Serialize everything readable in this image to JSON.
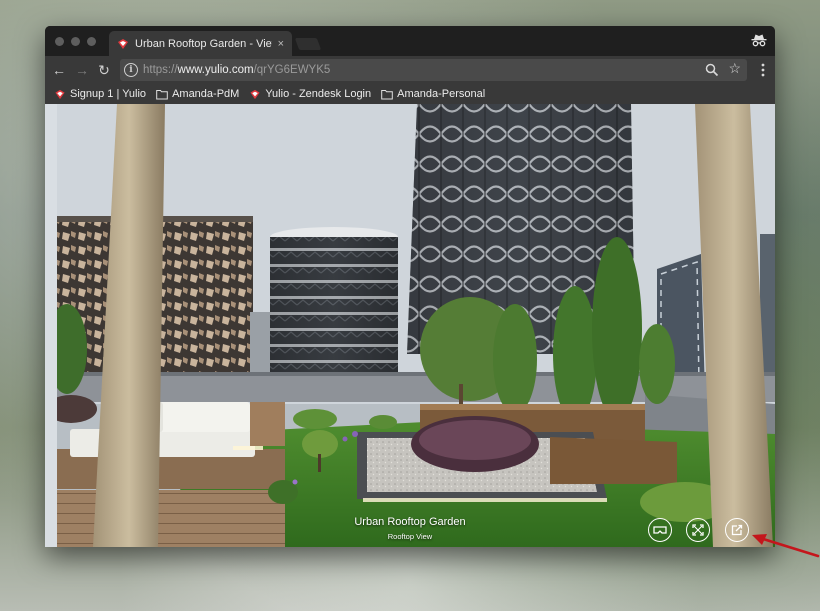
{
  "tab": {
    "title": "Urban Rooftop Garden - View",
    "close_glyph": "×"
  },
  "toolbar": {
    "back_glyph": "←",
    "forward_glyph": "→",
    "reload_glyph": "↻",
    "info_glyph": "i",
    "url_scheme": "https://",
    "url_host": "www.yulio.com",
    "url_path": "/qrYG6EWYK5",
    "star_glyph": "☆"
  },
  "bookmarks": [
    {
      "label": "Signup 1 | Yulio",
      "icon": "yulio-icon"
    },
    {
      "label": "Amanda-PdM",
      "icon": "folder-icon"
    },
    {
      "label": "Yulio - Zendesk Login",
      "icon": "yulio-icon"
    },
    {
      "label": "Amanda-Personal",
      "icon": "folder-icon"
    }
  ],
  "scene": {
    "title": "Urban Rooftop Garden",
    "subtitle": "Rooftop View",
    "controls": [
      "vr-headset-icon",
      "fullscreen-icon",
      "share-icon"
    ]
  },
  "colors": {
    "window_frame": "#1f1f1f",
    "toolbar": "#393939",
    "omnibox": "#4a4a4a",
    "yulio_red": "#e0393e",
    "annotation_arrow": "#c4161c"
  }
}
